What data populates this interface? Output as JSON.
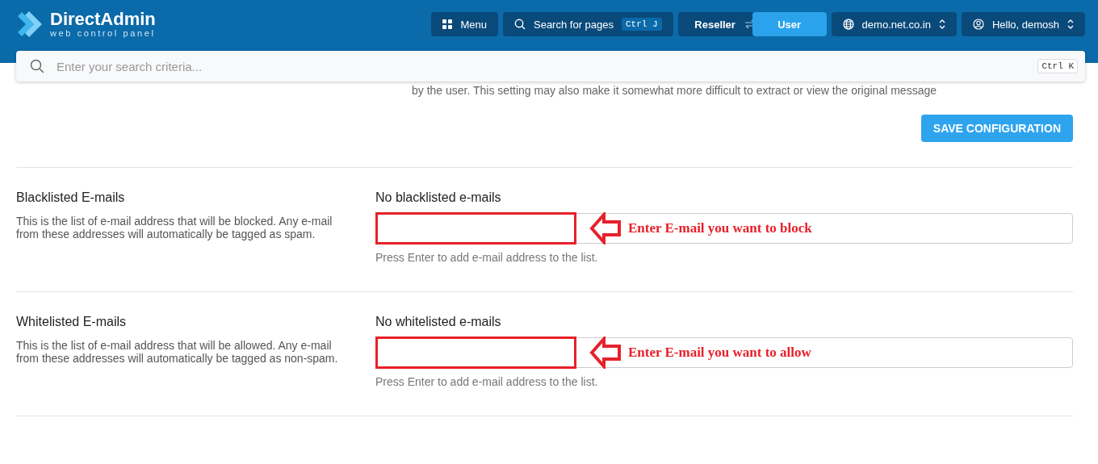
{
  "header": {
    "logo_title": "DirectAdmin",
    "logo_subtitle": "web control panel",
    "menu_button": "Menu",
    "page_search": {
      "label": "Search for pages",
      "shortcut": "Ctrl J"
    },
    "role_switch": [
      {
        "label": "Reseller",
        "selected": false
      },
      {
        "label": "User",
        "selected": true
      }
    ],
    "domain_select": "demo.net.co.in",
    "user_menu": "Hello, demosh"
  },
  "search": {
    "placeholder": "Enter your search criteria...",
    "shortcut": "Ctrl K"
  },
  "previous_description": "by the user. This setting may also make it somewhat more difficult to extract or view the original message",
  "save_button": "SAVE CONFIGURATION",
  "sections": [
    {
      "title": "Blacklisted E-mails",
      "description": "This is the list of e-mail address that will be blocked. Any e-mail from these addresses will automatically be tagged as spam.",
      "list_status": "No blacklisted e-mails",
      "help": "Press Enter to add e-mail address to the list.",
      "annotation": "Enter E-mail you want to block"
    },
    {
      "title": "Whitelisted E-mails",
      "description": "This is the list of e-mail address that will be allowed. Any e-mail from these addresses will automatically be tagged as non-spam.",
      "list_status": "No whitelisted e-mails",
      "help": "Press Enter to add e-mail address to the list.",
      "annotation": "Enter E-mail you want to allow"
    }
  ]
}
